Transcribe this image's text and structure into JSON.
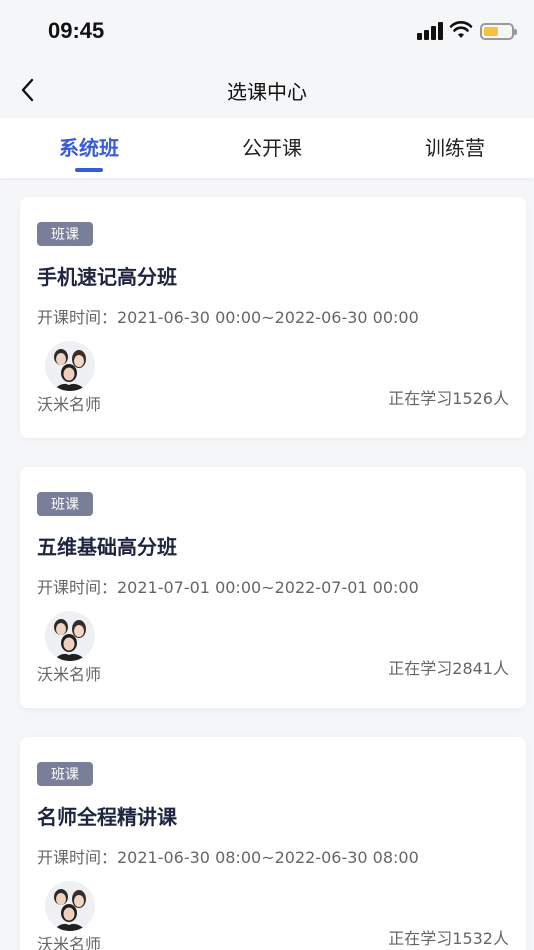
{
  "status": {
    "time": "09:45",
    "battery_level": 0.55,
    "battery_color": "#f6c23e"
  },
  "nav": {
    "back_icon": "chevron-left-icon",
    "title": "选课中心"
  },
  "tabs": [
    {
      "label": "系统班",
      "active": true
    },
    {
      "label": "公开课",
      "active": false
    },
    {
      "label": "训练营",
      "active": false
    }
  ],
  "accent_color": "#3a5bd9",
  "courses": [
    {
      "badge": "班课",
      "title": "手机速记高分班",
      "time": "开课时间：2021-06-30 00:00~2022-06-30 00:00",
      "teacher": "沃米名师",
      "learning": "正在学习1526人"
    },
    {
      "badge": "班课",
      "title": "五维基础高分班",
      "time": "开课时间：2021-07-01 00:00~2022-07-01 00:00",
      "teacher": "沃米名师",
      "learning": "正在学习2841人"
    },
    {
      "badge": "班课",
      "title": "名师全程精讲课",
      "time": "开课时间：2021-06-30 08:00~2022-06-30 08:00",
      "teacher": "沃米名师",
      "learning": "正在学习1532人"
    }
  ]
}
